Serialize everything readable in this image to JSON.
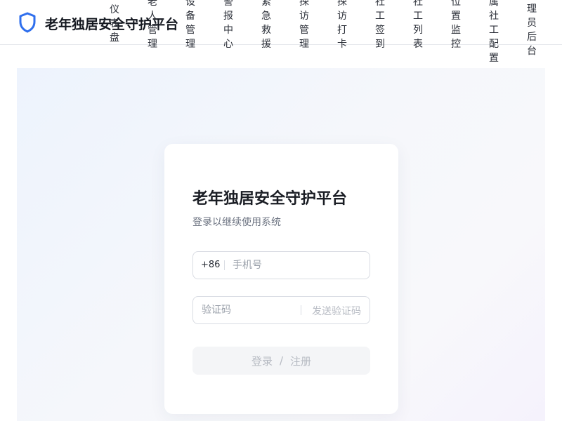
{
  "app": {
    "title": "老年独居安全守护平台",
    "brand_color": "#2f6fed"
  },
  "nav": {
    "items": [
      {
        "label": "仪表盘"
      },
      {
        "label": "老人管理"
      },
      {
        "label": "设备管理"
      },
      {
        "label": "警报中心"
      },
      {
        "label": "紧急救援"
      },
      {
        "label": "探访管理"
      },
      {
        "label": "探访打卡"
      },
      {
        "label": "社工签到"
      },
      {
        "label": "社工列表"
      },
      {
        "label": "位置监控"
      },
      {
        "label": "属社工配置"
      },
      {
        "label": "理员后台"
      }
    ]
  },
  "login": {
    "title": "老年独居安全守护平台",
    "subtitle": "登录以继续使用系统",
    "phone_prefix": "+86",
    "phone_placeholder": "手机号",
    "code_placeholder": "验证码",
    "send_code_label": "发送验证码",
    "submit_login": "登录",
    "submit_divider": "/",
    "submit_register": "注册"
  }
}
